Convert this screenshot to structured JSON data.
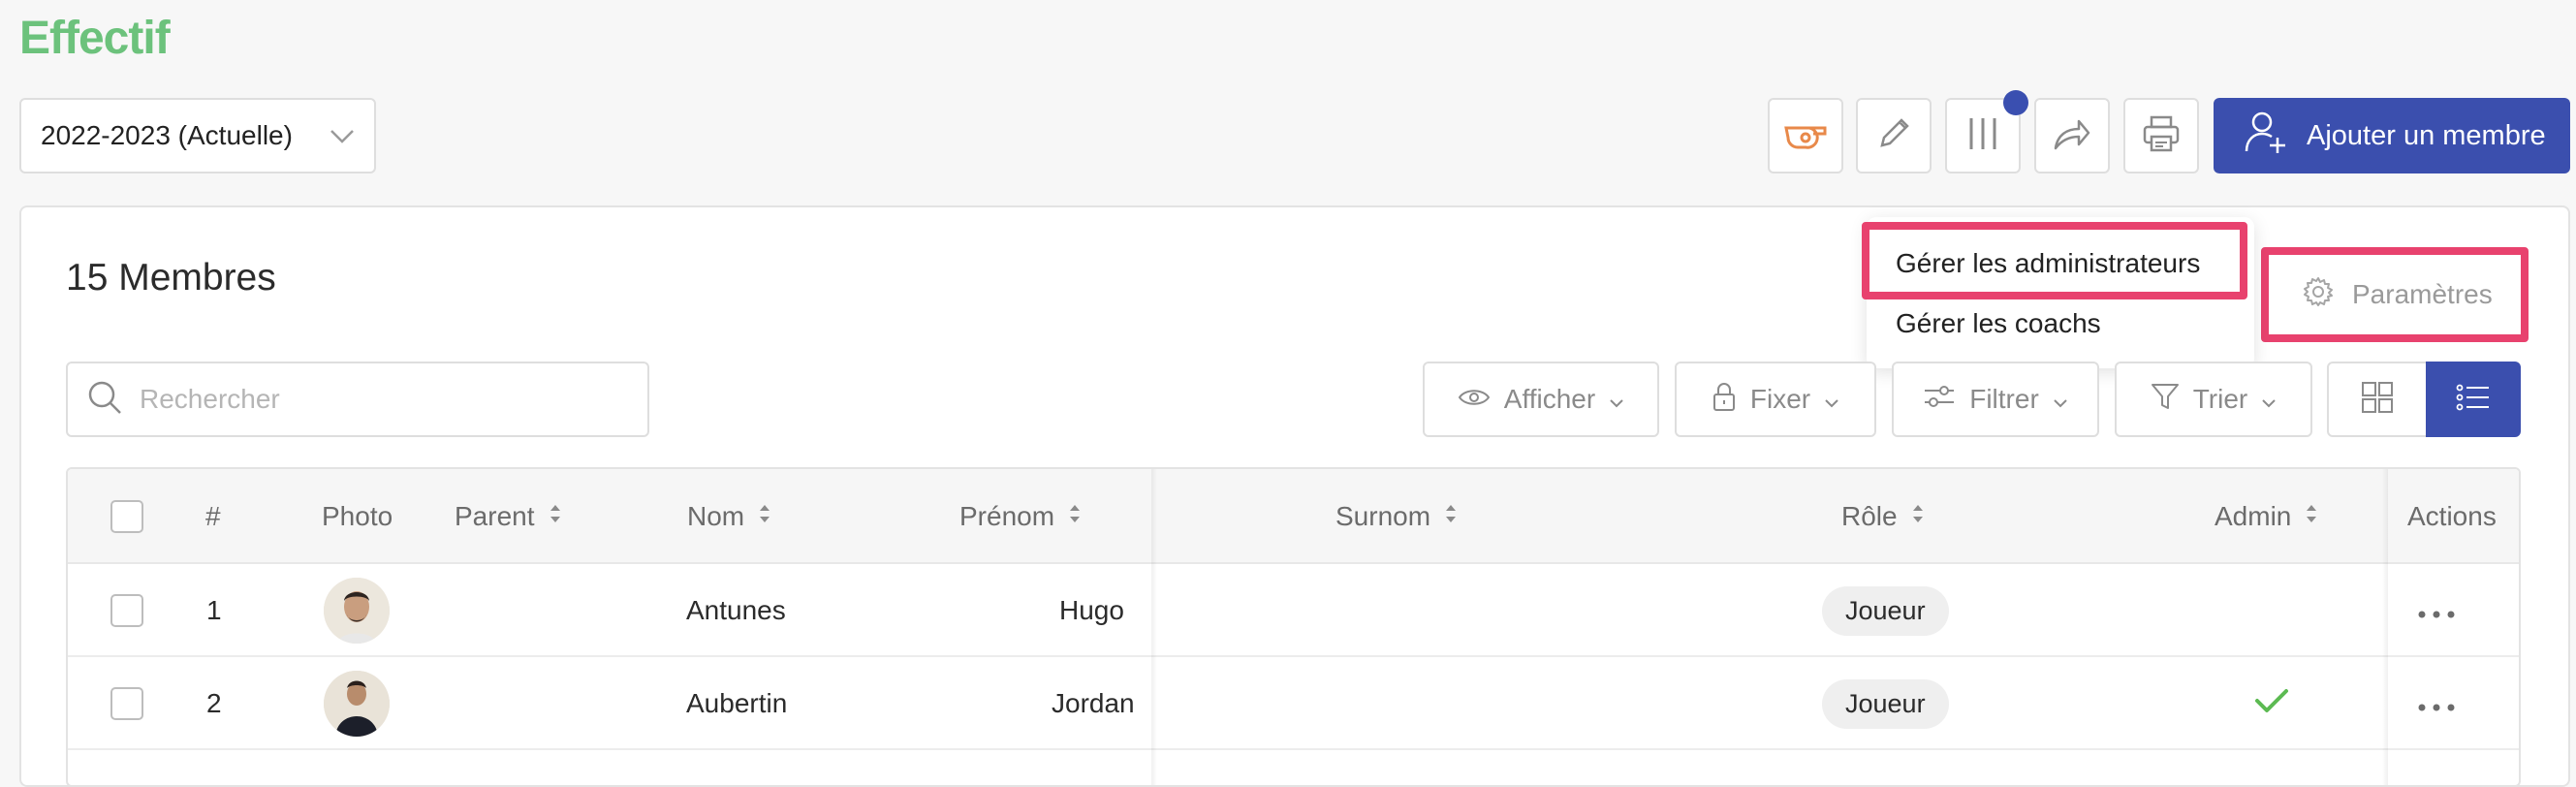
{
  "page": {
    "title": "Effectif",
    "season": "2022-2023 (Actuelle)",
    "add_member_label": "Ajouter un membre",
    "accent_color": "#3b4fae",
    "title_color": "#6cc27c",
    "highlight_color": "#e8426e"
  },
  "card": {
    "members_count": "15 Membres",
    "settings_label": "Paramètres"
  },
  "dropdown": {
    "items": [
      "Gérer les administrateurs",
      "Gérer les coachs"
    ]
  },
  "search": {
    "placeholder": "Rechercher"
  },
  "filters": {
    "show": "Afficher",
    "pin": "Fixer",
    "filter": "Filtrer",
    "sort": "Trier"
  },
  "table": {
    "columns": [
      "#",
      "Photo",
      "Parent",
      "Nom",
      "Prénom",
      "Surnom",
      "Rôle",
      "Admin",
      "Actions"
    ],
    "rows": [
      {
        "num": "1",
        "nom": "Antunes",
        "prenom": "Hugo",
        "surnom": "",
        "role": "Joueur",
        "admin": false
      },
      {
        "num": "2",
        "nom": "Aubertin",
        "prenom": "Jordan",
        "surnom": "",
        "role": "Joueur",
        "admin": true
      }
    ]
  }
}
